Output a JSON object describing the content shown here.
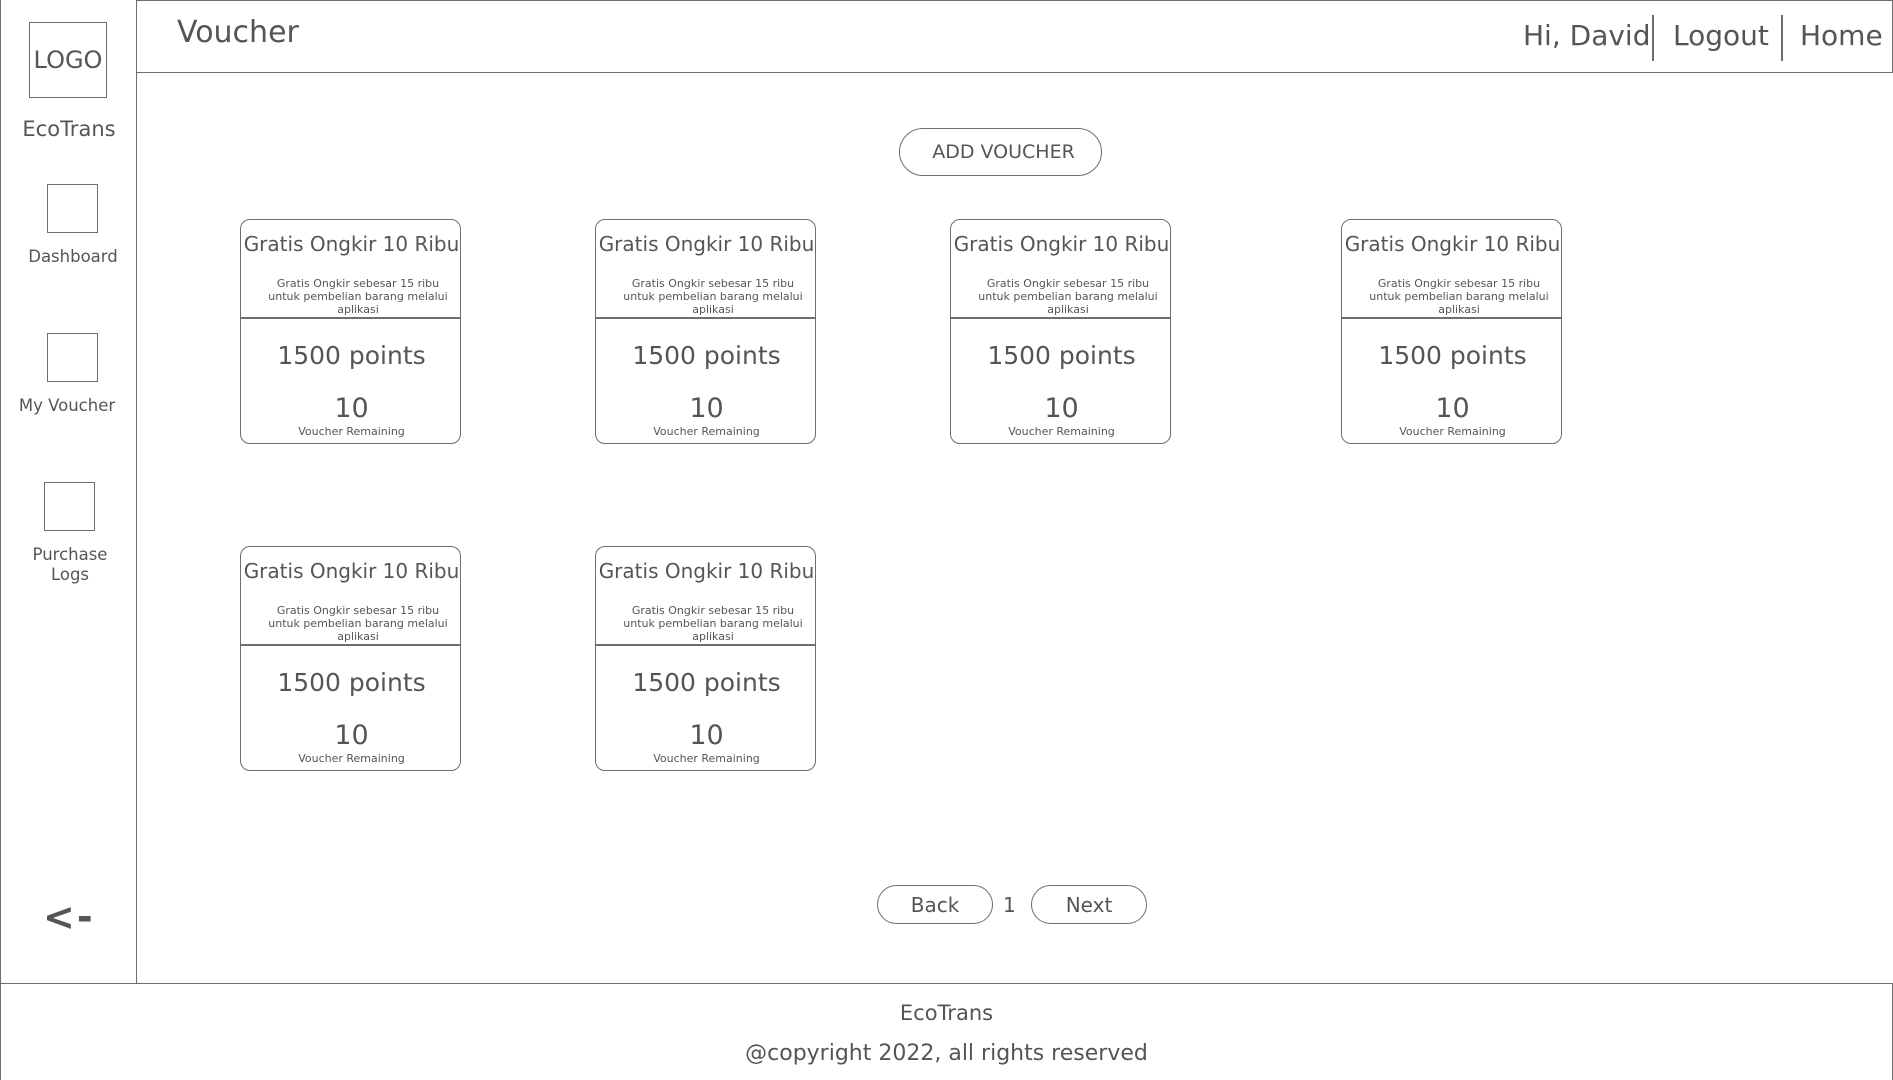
{
  "sidebar": {
    "logo_text": "LOGO",
    "brand": "EcoTrans",
    "items": [
      {
        "label": "Dashboard"
      },
      {
        "label": "My Voucher"
      },
      {
        "label": "Purchase\nLogs"
      }
    ],
    "collapse_label": "<-"
  },
  "header": {
    "title": "Voucher",
    "greeting": "Hi, David",
    "logout": "Logout",
    "home": "Home"
  },
  "actions": {
    "add_voucher": "ADD VOUCHER"
  },
  "vouchers": [
    {
      "title": "Gratis Ongkir 10 Ribu",
      "description": "Gratis Ongkir sebesar 15 ribu untuk pembelian barang melalui aplikasi",
      "points": "1500 points",
      "remaining": "10",
      "remaining_label": "Voucher Remaining"
    },
    {
      "title": "Gratis Ongkir 10 Ribu",
      "description": "Gratis Ongkir sebesar 15 ribu untuk pembelian barang melalui aplikasi",
      "points": "1500 points",
      "remaining": "10",
      "remaining_label": "Voucher Remaining"
    },
    {
      "title": "Gratis Ongkir 10 Ribu",
      "description": "Gratis Ongkir sebesar 15 ribu untuk pembelian barang melalui aplikasi",
      "points": "1500 points",
      "remaining": "10",
      "remaining_label": "Voucher Remaining"
    },
    {
      "title": "Gratis Ongkir 10 Ribu",
      "description": "Gratis Ongkir sebesar 15 ribu untuk pembelian barang melalui aplikasi",
      "points": "1500 points",
      "remaining": "10",
      "remaining_label": "Voucher Remaining"
    },
    {
      "title": "Gratis Ongkir 10 Ribu",
      "description": "Gratis Ongkir sebesar 15 ribu untuk pembelian barang melalui aplikasi",
      "points": "1500 points",
      "remaining": "10",
      "remaining_label": "Voucher Remaining"
    },
    {
      "title": "Gratis Ongkir 10 Ribu",
      "description": "Gratis Ongkir sebesar 15 ribu untuk pembelian barang melalui aplikasi",
      "points": "1500 points",
      "remaining": "10",
      "remaining_label": "Voucher Remaining"
    }
  ],
  "pagination": {
    "back": "Back",
    "page": "1",
    "next": "Next"
  },
  "footer": {
    "brand": "EcoTrans",
    "copyright": "@copyright 2022, all rights reserved"
  }
}
